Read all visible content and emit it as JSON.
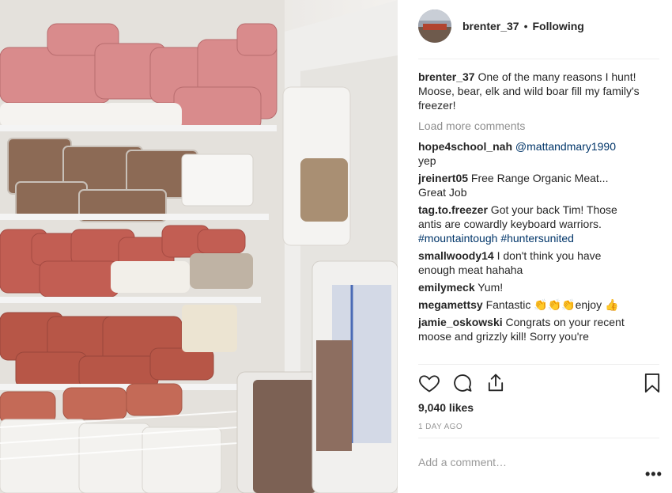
{
  "post": {
    "username": "brenter_37",
    "separator": "•",
    "follow_status": "Following",
    "caption": {
      "username": "brenter_37",
      "text": " One of the many reasons I hunt! Moose, bear, elk and wild boar fill my family's freezer!"
    },
    "load_more": "Load more comments",
    "comments": [
      {
        "username": "hope4school_nah",
        "parts": [
          " ",
          {
            "mention": "@mattandmary1990"
          },
          " yep"
        ]
      },
      {
        "username": "jreinert05",
        "parts": [
          " Free Range Organic Meat... Great Job"
        ]
      },
      {
        "username": "tag.to.freezer",
        "parts": [
          " Got your back Tim! Those antis are cowardly keyboard warriors. ",
          {
            "tag": "#mountaintough"
          },
          " ",
          {
            "tag": "#huntersunited"
          }
        ]
      },
      {
        "username": "smallwoody14",
        "parts": [
          " I don't think you have enough meat hahaha"
        ]
      },
      {
        "username": "emilymeck",
        "parts": [
          " Yum!"
        ]
      },
      {
        "username": "megamettsy",
        "parts": [
          " Fantastic ",
          {
            "emoji": "👏👏👏"
          },
          "enjoy ",
          {
            "emoji": "👍"
          }
        ]
      },
      {
        "username": "jamie_oskowski",
        "parts": [
          " Congrats on your recent moose and grizzly kill! Sorry you're"
        ]
      }
    ],
    "likes": "9,040 likes",
    "timestamp": "1 DAY AGO",
    "add_comment_placeholder": "Add a comment…",
    "more_label": "•••",
    "icons": {
      "like": "heart-icon",
      "comment": "comment-icon",
      "share": "share-icon",
      "save": "bookmark-icon",
      "more": "more-options-icon"
    },
    "colors": {
      "link": "#003569",
      "muted": "#8e8e8e",
      "text": "#262626"
    }
  }
}
